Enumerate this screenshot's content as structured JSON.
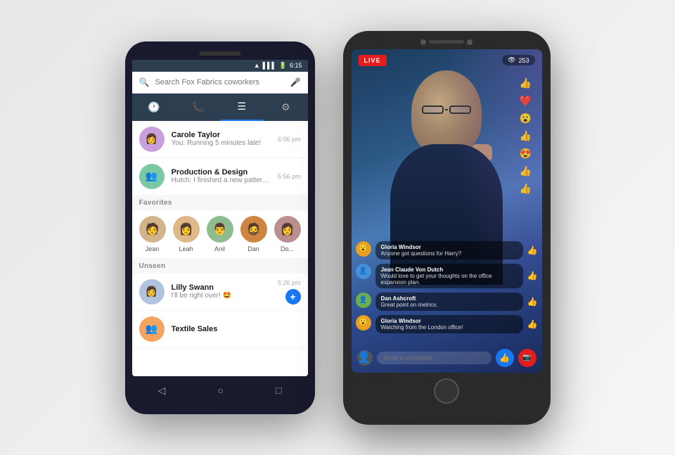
{
  "left_phone": {
    "status_bar": {
      "time": "6:15",
      "icons": [
        "wifi",
        "signal",
        "battery"
      ]
    },
    "search": {
      "placeholder": "Search Fox Fabrics coworkers"
    },
    "nav_tabs": [
      {
        "id": "recent",
        "icon": "🕐",
        "active": false
      },
      {
        "id": "calls",
        "icon": "📞",
        "active": false
      },
      {
        "id": "chats",
        "icon": "☰",
        "active": true
      },
      {
        "id": "settings",
        "icon": "⚙",
        "active": false
      }
    ],
    "conversations": [
      {
        "name": "Carole Taylor",
        "preview": "You: Running 5 minutes late!",
        "time": "6:06 pm",
        "avatar_color": "#c9a0dc"
      },
      {
        "name": "Production & Design",
        "preview": "Hutch: I finished a new pattern...",
        "time": "5:56 pm",
        "avatar_color": "#7bc8a4"
      }
    ],
    "favorites_label": "Favorites",
    "favorites": [
      {
        "name": "Jean",
        "avatar_color": "#d2b48c"
      },
      {
        "name": "Leah",
        "avatar_color": "#deb887"
      },
      {
        "name": "Anil",
        "avatar_color": "#8fbc8f"
      },
      {
        "name": "Dan",
        "avatar_color": "#cd853f"
      },
      {
        "name": "Do...",
        "avatar_color": "#bc8f8f"
      }
    ],
    "unseen_label": "Unseen",
    "unseen_conversations": [
      {
        "name": "Lilly Swann",
        "preview": "I'll be right over! 🤩",
        "time": "5:26 pm",
        "avatar_color": "#b0c4de"
      },
      {
        "name": "Textile Sales",
        "preview": "",
        "time": "",
        "avatar_color": "#f4a460"
      }
    ],
    "fab_label": "+",
    "bottom_nav": [
      "◁",
      "○",
      "□"
    ]
  },
  "right_phone": {
    "live_badge": "LIVE",
    "viewer_count": "253",
    "eye_icon": "👁",
    "reactions": [
      "👍",
      "❤️",
      "😮",
      "👍",
      "😍",
      "👍",
      "👍"
    ],
    "comments": [
      {
        "name": "Gloria Windsor",
        "text": "Anyone got questions for Harry?",
        "avatar_color": "#e8a020"
      },
      {
        "name": "Jean Claude Von Dutch",
        "text": "Would love to get your thoughts on the office expansion plan.",
        "avatar_color": "#4a90d9"
      },
      {
        "name": "Dan Ashcroft",
        "text": "Great point on metrics.",
        "avatar_color": "#6ab04c"
      },
      {
        "name": "Gloria Windsor",
        "text": "Watching from the London office!",
        "avatar_color": "#e8a020"
      }
    ],
    "comment_placeholder": "Write a comment...",
    "like_icon": "👍",
    "camera_icon": "📷"
  }
}
